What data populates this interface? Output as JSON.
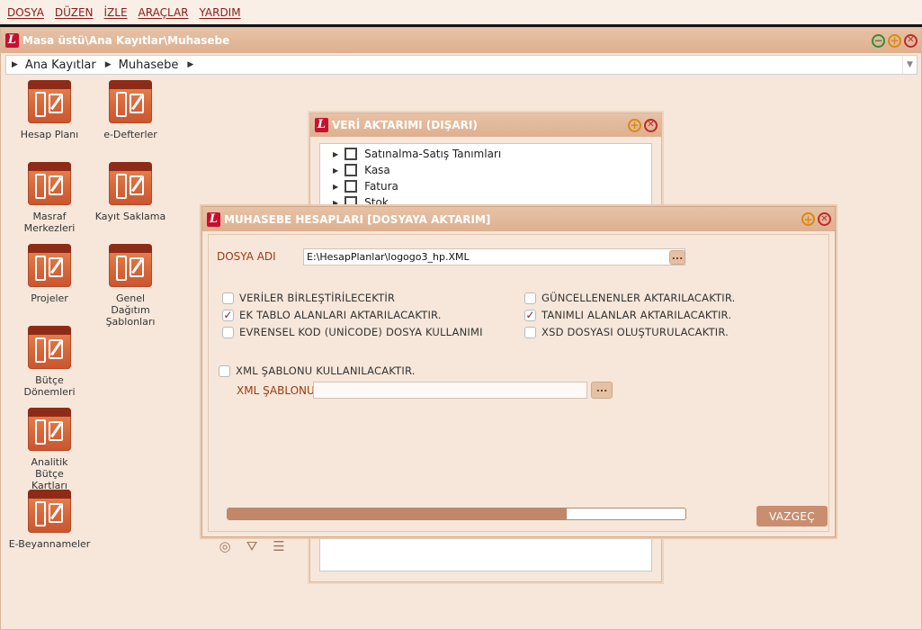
{
  "menu": {
    "items": [
      "DOSYA",
      "DÜZEN",
      "İZLE",
      "ARAÇLAR",
      "YARDIM"
    ]
  },
  "main_window": {
    "title": "Masa üstü\\Ana Kayıtlar\\Muhasebe",
    "breadcrumb": [
      "Ana Kayıtlar",
      "Muhasebe"
    ]
  },
  "desktop_icons": [
    {
      "label": "Hesap Planı",
      "icon": "accounting-doc-icon"
    },
    {
      "label": "e-Defterler",
      "icon": "accounting-doc-icon"
    },
    {
      "label": "Masraf Merkezleri",
      "icon": "accounting-doc-icon"
    },
    {
      "label": "Kayıt Saklama",
      "icon": "accounting-doc-icon"
    },
    {
      "label": "Projeler",
      "icon": "accounting-doc-icon"
    },
    {
      "label": "Genel Dağıtım Şablonları",
      "icon": "accounting-doc-icon"
    },
    {
      "label": "Bütçe Dönemleri",
      "icon": "accounting-doc-icon"
    },
    {
      "label": "Analitik Bütçe Kartları",
      "icon": "accounting-doc-icon"
    },
    {
      "label": "E-Beyannameler",
      "icon": "accounting-doc-icon"
    }
  ],
  "export_dialog": {
    "title": "VERİ AKTARIMI (DIŞARI)",
    "tree": [
      "Satınalma-Satış Tanımları",
      "Kasa",
      "Fatura",
      "Stok"
    ]
  },
  "accounts_dialog": {
    "title": "MUHASEBE HESAPLARI [DOSYAYA AKTARIM]",
    "file_label": "DOSYA ADI",
    "file_value": "E:\\HesapPlanlar\\logogo3_hp.XML",
    "ellipsis": "...",
    "options": [
      {
        "label": "VERİLER BİRLEŞTİRİLECEKTİR",
        "checked": false
      },
      {
        "label": "GÜNCELLENENLER AKTARILACAKTIR.",
        "checked": false
      },
      {
        "label": "EK TABLO ALANLARI AKTARILACAKTIR.",
        "checked": true
      },
      {
        "label": "TANIMLI ALANLAR AKTARILACAKTIR.",
        "checked": true
      },
      {
        "label": "EVRENSEL KOD (UNİCODE) DOSYA KULLANIMI",
        "checked": false
      },
      {
        "label": "XSD DOSYASI OLUŞTURULACAKTIR.",
        "checked": false
      }
    ],
    "xml_template_option": {
      "label": "XML ŞABLONU KULLANILACAKTIR.",
      "checked": false
    },
    "xml_template_label": "XML ŞABLONU",
    "xml_template_value": "",
    "progress": 0.74,
    "cancel_label": "VAZGEÇ"
  },
  "colors": {
    "accent": "#c88e6f",
    "title_bar": "#ddb090",
    "background": "#f6e7da",
    "menu_text": "#8b1a1a"
  }
}
